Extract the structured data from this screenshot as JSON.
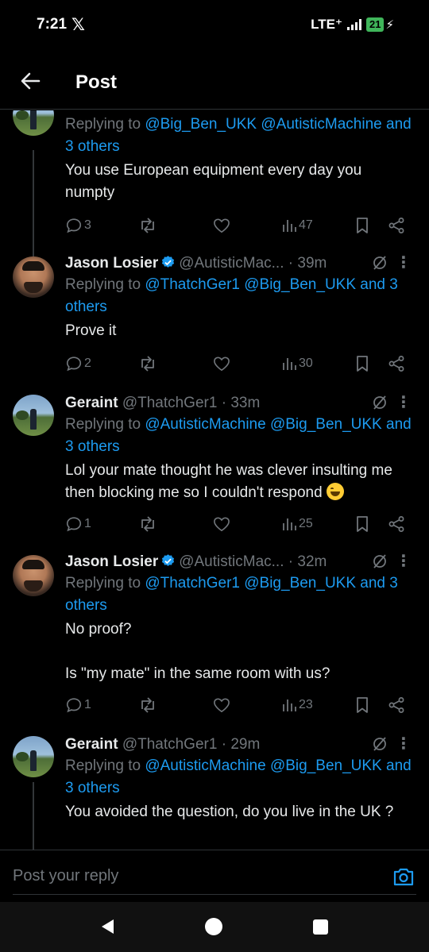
{
  "status_bar": {
    "time": "7:21",
    "app_icon": "x-logo-icon",
    "network": "LTE⁺",
    "battery": "21"
  },
  "header": {
    "title": "Post",
    "back_icon": "back-arrow-icon"
  },
  "tweets": [
    {
      "name": "",
      "handle": "",
      "time": "",
      "replying_prefix": "Replying to ",
      "mentions": [
        "@Big_Ben_UKK",
        "@AutisticMachine"
      ],
      "others": "and 3 others",
      "text": [
        "You use European equipment every day you numpty"
      ],
      "replies": "3",
      "views": "47"
    },
    {
      "name": "Jason Losier",
      "handle": "@AutisticMac...",
      "time": "· 39m",
      "verified": true,
      "replying_prefix": "Replying to ",
      "mentions": [
        "@ThatchGer1",
        "@Big_Ben_UKK"
      ],
      "others": "and 3 others",
      "text": [
        "Prove it"
      ],
      "replies": "2",
      "views": "30"
    },
    {
      "name": "Geraint",
      "handle": "@ThatchGer1",
      "time": "· 33m",
      "replying_prefix": "Replying to ",
      "mentions": [
        "@AutisticMachine",
        "@Big_Ben_UKK"
      ],
      "others": "and 3 others",
      "text": [
        "Lol your mate thought he was clever insulting me then blocking me so I couldn't respond"
      ],
      "replies": "1",
      "views": "25"
    },
    {
      "name": "Jason Losier",
      "handle": "@AutisticMac...",
      "time": "· 32m",
      "verified": true,
      "replying_prefix": "Replying to ",
      "mentions": [
        "@ThatchGer1",
        "@Big_Ben_UKK"
      ],
      "others": "and 3 others",
      "text": [
        "No proof?",
        "",
        "Is \"my mate\" in the same room with us?"
      ],
      "replies": "1",
      "views": "23"
    },
    {
      "name": "Geraint",
      "handle": "@ThatchGer1",
      "time": "· 29m",
      "replying_prefix": "Replying to ",
      "mentions": [
        "@AutisticMachine",
        "@Big_Ben_UKK"
      ],
      "others": "and 3 others",
      "text": [
        "You avoided the question, do you live in the UK ?"
      ]
    }
  ],
  "reply_box": {
    "placeholder": "Post your reply"
  },
  "colors": {
    "accent": "#1d9bf0",
    "muted": "#71767b",
    "text": "#e7e9ea",
    "background": "#000000",
    "battery": "#3fb55a"
  }
}
